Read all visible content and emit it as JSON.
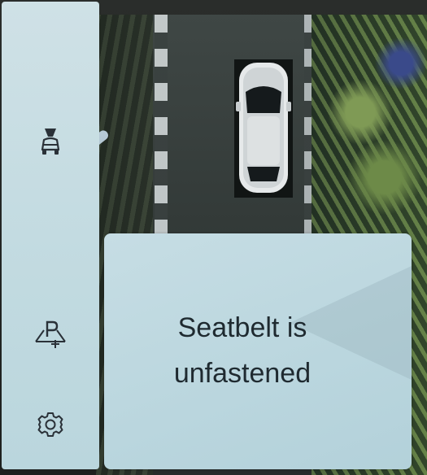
{
  "icons": {
    "camera_view": "car-camera-view-icon",
    "parking_assist": "parking-assist-icon",
    "settings": "gear-icon"
  },
  "message": {
    "line1": "Seatbelt is",
    "line2": "unfastened"
  },
  "colors": {
    "panel": "#c3dbe1",
    "text": "#1f2a30",
    "icon": "#2a3138"
  }
}
